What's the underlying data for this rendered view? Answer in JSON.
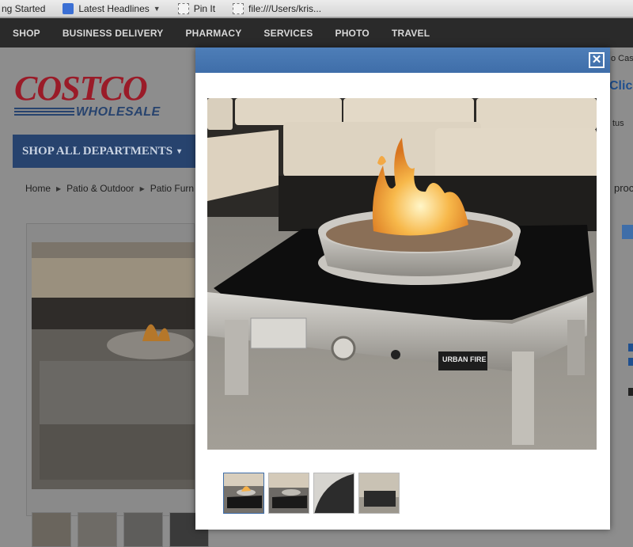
{
  "bookmarks": {
    "items": [
      {
        "label": "ng Started",
        "icon": "page-icon"
      },
      {
        "label": "Latest Headlines",
        "icon": "rss-icon"
      },
      {
        "label": "Pin It",
        "icon": "page-icon"
      },
      {
        "label": "file:///Users/kris...",
        "icon": "page-icon"
      }
    ]
  },
  "nav": {
    "items": [
      "SHOP",
      "BUSINESS DELIVERY",
      "PHARMACY",
      "SERVICES",
      "PHOTO",
      "TRAVEL"
    ]
  },
  "header": {
    "logo_main": "COSTCO",
    "logo_sub": "WHOLESALE",
    "department_button": "SHOP ALL DEPARTMENTS",
    "right_snips": [
      "o Cash",
      "Click",
      "tus",
      "proc"
    ]
  },
  "breadcrumb": [
    "Home",
    "Patio & Outdoor",
    "Patio Furn"
  ],
  "modal": {
    "close_label": "✕",
    "main_image_alt": "URBAN FIRE fire table on patio",
    "thumbnails": [
      "fire-table-lit",
      "fire-table-off",
      "fire-table-detail",
      "fire-table-cover"
    ],
    "brand_plate": "URBAN FIRE"
  },
  "colors": {
    "modal_bar": "#4577b1",
    "nav_bg": "#2a2a2a",
    "brand_red": "#9a1b28",
    "brand_blue": "#27436e"
  }
}
